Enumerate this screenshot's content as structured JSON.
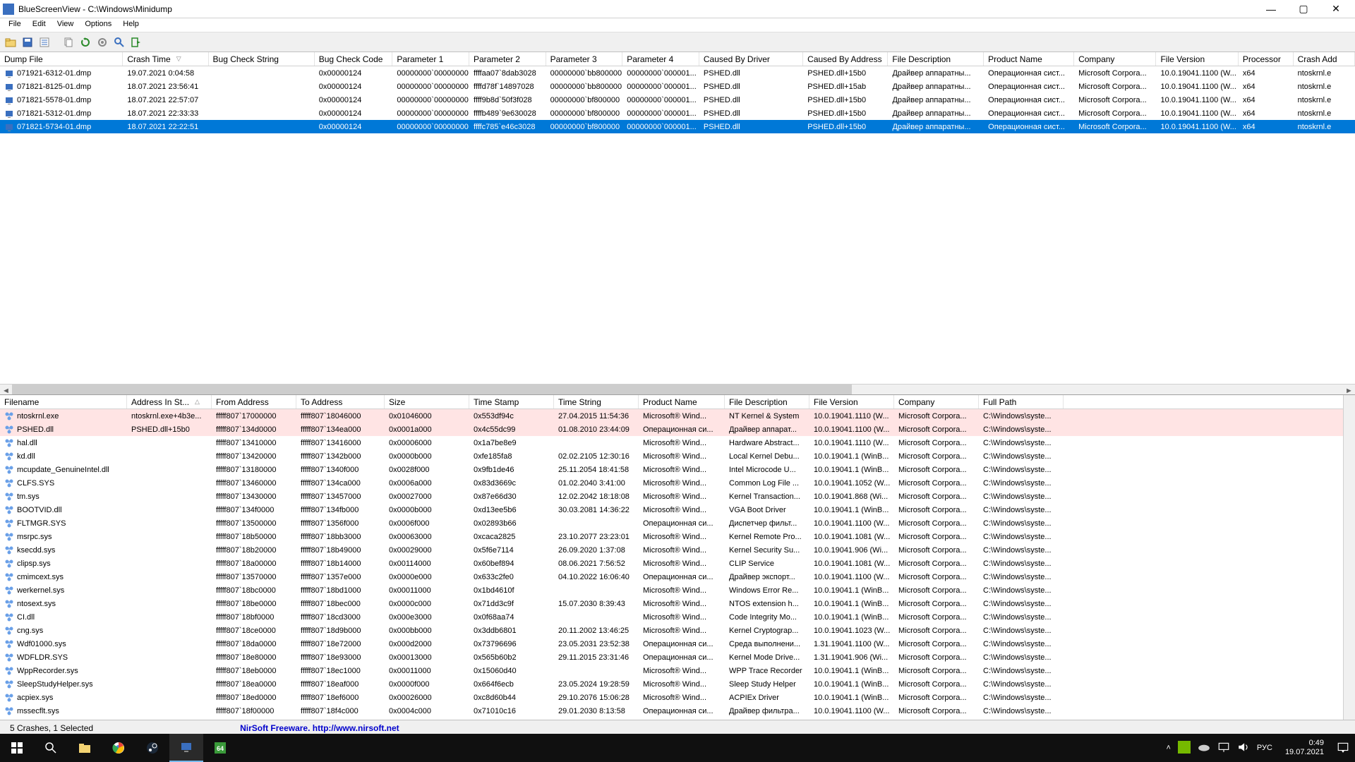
{
  "window": {
    "title": "BlueScreenView - C:\\Windows\\Minidump"
  },
  "menu": [
    "File",
    "Edit",
    "View",
    "Options",
    "Help"
  ],
  "top": {
    "columns": [
      "Dump File",
      "Crash Time",
      "Bug Check String",
      "Bug Check Code",
      "Parameter 1",
      "Parameter 2",
      "Parameter 3",
      "Parameter 4",
      "Caused By Driver",
      "Caused By Address",
      "File Description",
      "Product Name",
      "Company",
      "File Version",
      "Processor",
      "Crash Add"
    ],
    "sorted_col": 1,
    "rows": [
      {
        "sel": false,
        "c": [
          "071921-6312-01.dmp",
          "19.07.2021 0:04:58",
          "",
          "0x00000124",
          "00000000`00000000",
          "ffffaa07`8dab3028",
          "00000000`bb800000",
          "00000000`000001...",
          "PSHED.dll",
          "PSHED.dll+15b0",
          "Драйвер аппаратны...",
          "Операционная сист...",
          "Microsoft Corpora...",
          "10.0.19041.1100 (W...",
          "x64",
          "ntoskrnl.e"
        ]
      },
      {
        "sel": false,
        "c": [
          "071821-8125-01.dmp",
          "18.07.2021 23:56:41",
          "",
          "0x00000124",
          "00000000`00000000",
          "ffffd78f`14897028",
          "00000000`bb800000",
          "00000000`000001...",
          "PSHED.dll",
          "PSHED.dll+15ab",
          "Драйвер аппаратны...",
          "Операционная сист...",
          "Microsoft Corpora...",
          "10.0.19041.1100 (W...",
          "x64",
          "ntoskrnl.e"
        ]
      },
      {
        "sel": false,
        "c": [
          "071821-5578-01.dmp",
          "18.07.2021 22:57:07",
          "",
          "0x00000124",
          "00000000`00000000",
          "ffff9b8d`50f3f028",
          "00000000`bf800000",
          "00000000`000001...",
          "PSHED.dll",
          "PSHED.dll+15b0",
          "Драйвер аппаратны...",
          "Операционная сист...",
          "Microsoft Corpora...",
          "10.0.19041.1100 (W...",
          "x64",
          "ntoskrnl.e"
        ]
      },
      {
        "sel": false,
        "c": [
          "071821-5312-01.dmp",
          "18.07.2021 22:33:33",
          "",
          "0x00000124",
          "00000000`00000000",
          "ffffb489`9e630028",
          "00000000`bf800000",
          "00000000`000001...",
          "PSHED.dll",
          "PSHED.dll+15b0",
          "Драйвер аппаратны...",
          "Операционная сист...",
          "Microsoft Corpora...",
          "10.0.19041.1100 (W...",
          "x64",
          "ntoskrnl.e"
        ]
      },
      {
        "sel": true,
        "c": [
          "071821-5734-01.dmp",
          "18.07.2021 22:22:51",
          "",
          "0x00000124",
          "00000000`00000000",
          "ffffc785`e46c3028",
          "00000000`bf800000",
          "00000000`000001...",
          "PSHED.dll",
          "PSHED.dll+15b0",
          "Драйвер аппаратны...",
          "Операционная сист...",
          "Microsoft Corpora...",
          "10.0.19041.1100 (W...",
          "x64",
          "ntoskrnl.e"
        ]
      }
    ]
  },
  "bottom": {
    "columns": [
      "Filename",
      "Address In St...",
      "From Address",
      "To Address",
      "Size",
      "Time Stamp",
      "Time String",
      "Product Name",
      "File Description",
      "File Version",
      "Company",
      "Full Path"
    ],
    "sorted_col": 1,
    "rows": [
      {
        "pink": true,
        "c": [
          "ntoskrnl.exe",
          "ntoskrnl.exe+4b3e...",
          "fffff807`17000000",
          "fffff807`18046000",
          "0x01046000",
          "0x553df94c",
          "27.04.2015 11:54:36",
          "Microsoft® Wind...",
          "NT Kernel & System",
          "10.0.19041.1110 (W...",
          "Microsoft Corpora...",
          "C:\\Windows\\syste..."
        ]
      },
      {
        "pink": true,
        "c": [
          "PSHED.dll",
          "PSHED.dll+15b0",
          "fffff807`134d0000",
          "fffff807`134ea000",
          "0x0001a000",
          "0x4c55dc99",
          "01.08.2010 23:44:09",
          "Операционная си...",
          "Драйвер аппарат...",
          "10.0.19041.1100 (W...",
          "Microsoft Corpora...",
          "C:\\Windows\\syste..."
        ]
      },
      {
        "pink": false,
        "c": [
          "hal.dll",
          "",
          "fffff807`13410000",
          "fffff807`13416000",
          "0x00006000",
          "0x1a7be8e9",
          "",
          "Microsoft® Wind...",
          "Hardware Abstract...",
          "10.0.19041.1110 (W...",
          "Microsoft Corpora...",
          "C:\\Windows\\syste..."
        ]
      },
      {
        "pink": false,
        "c": [
          "kd.dll",
          "",
          "fffff807`13420000",
          "fffff807`1342b000",
          "0x0000b000",
          "0xfe185fa8",
          "02.02.2105 12:30:16",
          "Microsoft® Wind...",
          "Local Kernel Debu...",
          "10.0.19041.1 (WinB...",
          "Microsoft Corpora...",
          "C:\\Windows\\syste..."
        ]
      },
      {
        "pink": false,
        "c": [
          "mcupdate_GenuineIntel.dll",
          "",
          "fffff807`13180000",
          "fffff807`1340f000",
          "0x0028f000",
          "0x9fb1de46",
          "25.11.2054 18:41:58",
          "Microsoft® Wind...",
          "Intel Microcode U...",
          "10.0.19041.1 (WinB...",
          "Microsoft Corpora...",
          "C:\\Windows\\syste..."
        ]
      },
      {
        "pink": false,
        "c": [
          "CLFS.SYS",
          "",
          "fffff807`13460000",
          "fffff807`134ca000",
          "0x0006a000",
          "0x83d3669c",
          "01.02.2040 3:41:00",
          "Microsoft® Wind...",
          "Common Log File ...",
          "10.0.19041.1052 (W...",
          "Microsoft Corpora...",
          "C:\\Windows\\syste..."
        ]
      },
      {
        "pink": false,
        "c": [
          "tm.sys",
          "",
          "fffff807`13430000",
          "fffff807`13457000",
          "0x00027000",
          "0x87e66d30",
          "12.02.2042 18:18:08",
          "Microsoft® Wind...",
          "Kernel Transaction...",
          "10.0.19041.868 (Wi...",
          "Microsoft Corpora...",
          "C:\\Windows\\syste..."
        ]
      },
      {
        "pink": false,
        "c": [
          "BOOTVID.dll",
          "",
          "fffff807`134f0000",
          "fffff807`134fb000",
          "0x0000b000",
          "0xd13ee5b6",
          "30.03.2081 14:36:22",
          "Microsoft® Wind...",
          "VGA Boot Driver",
          "10.0.19041.1 (WinB...",
          "Microsoft Corpora...",
          "C:\\Windows\\syste..."
        ]
      },
      {
        "pink": false,
        "c": [
          "FLTMGR.SYS",
          "",
          "fffff807`13500000",
          "fffff807`1356f000",
          "0x0006f000",
          "0x02893b66",
          "",
          "Операционная си...",
          "Диспетчер фильт...",
          "10.0.19041.1100 (W...",
          "Microsoft Corpora...",
          "C:\\Windows\\syste..."
        ]
      },
      {
        "pink": false,
        "c": [
          "msrpc.sys",
          "",
          "fffff807`18b50000",
          "fffff807`18bb3000",
          "0x00063000",
          "0xcaca2825",
          "23.10.2077 23:23:01",
          "Microsoft® Wind...",
          "Kernel Remote Pro...",
          "10.0.19041.1081 (W...",
          "Microsoft Corpora...",
          "C:\\Windows\\syste..."
        ]
      },
      {
        "pink": false,
        "c": [
          "ksecdd.sys",
          "",
          "fffff807`18b20000",
          "fffff807`18b49000",
          "0x00029000",
          "0x5f6e7114",
          "26.09.2020 1:37:08",
          "Microsoft® Wind...",
          "Kernel Security Su...",
          "10.0.19041.906 (Wi...",
          "Microsoft Corpora...",
          "C:\\Windows\\syste..."
        ]
      },
      {
        "pink": false,
        "c": [
          "clipsp.sys",
          "",
          "fffff807`18a00000",
          "fffff807`18b14000",
          "0x00114000",
          "0x60bef894",
          "08.06.2021 7:56:52",
          "Microsoft® Wind...",
          "CLIP Service",
          "10.0.19041.1081 (W...",
          "Microsoft Corpora...",
          "C:\\Windows\\syste..."
        ]
      },
      {
        "pink": false,
        "c": [
          "cmimcext.sys",
          "",
          "fffff807`13570000",
          "fffff807`1357e000",
          "0x0000e000",
          "0x633c2fe0",
          "04.10.2022 16:06:40",
          "Операционная си...",
          "Драйвер экспорт...",
          "10.0.19041.1100 (W...",
          "Microsoft Corpora...",
          "C:\\Windows\\syste..."
        ]
      },
      {
        "pink": false,
        "c": [
          "werkernel.sys",
          "",
          "fffff807`18bc0000",
          "fffff807`18bd1000",
          "0x00011000",
          "0x1bd4610f",
          "",
          "Microsoft® Wind...",
          "Windows Error Re...",
          "10.0.19041.1 (WinB...",
          "Microsoft Corpora...",
          "C:\\Windows\\syste..."
        ]
      },
      {
        "pink": false,
        "c": [
          "ntosext.sys",
          "",
          "fffff807`18be0000",
          "fffff807`18bec000",
          "0x0000c000",
          "0x71dd3c9f",
          "15.07.2030 8:39:43",
          "Microsoft® Wind...",
          "NTOS extension h...",
          "10.0.19041.1 (WinB...",
          "Microsoft Corpora...",
          "C:\\Windows\\syste..."
        ]
      },
      {
        "pink": false,
        "c": [
          "CI.dll",
          "",
          "fffff807`18bf0000",
          "fffff807`18cd3000",
          "0x000e3000",
          "0x0f68aa74",
          "",
          "Microsoft® Wind...",
          "Code Integrity Mo...",
          "10.0.19041.1 (WinB...",
          "Microsoft Corpora...",
          "C:\\Windows\\syste..."
        ]
      },
      {
        "pink": false,
        "c": [
          "cng.sys",
          "",
          "fffff807`18ce0000",
          "fffff807`18d9b000",
          "0x000bb000",
          "0x3ddb6801",
          "20.11.2002 13:46:25",
          "Microsoft® Wind...",
          "Kernel Cryptograp...",
          "10.0.19041.1023 (W...",
          "Microsoft Corpora...",
          "C:\\Windows\\syste..."
        ]
      },
      {
        "pink": false,
        "c": [
          "Wdf01000.sys",
          "",
          "fffff807`18da0000",
          "fffff807`18e72000",
          "0x000d2000",
          "0x73796696",
          "23.05.2031 23:52:38",
          "Операционная си...",
          "Среда выполнени...",
          "1.31.19041.1100 (W...",
          "Microsoft Corpora...",
          "C:\\Windows\\syste..."
        ]
      },
      {
        "pink": false,
        "c": [
          "WDFLDR.SYS",
          "",
          "fffff807`18e80000",
          "fffff807`18e93000",
          "0x00013000",
          "0x565b60b2",
          "29.11.2015 23:31:46",
          "Операционная си...",
          "Kernel Mode Drive...",
          "1.31.19041.906 (Wi...",
          "Microsoft Corpora...",
          "C:\\Windows\\syste..."
        ]
      },
      {
        "pink": false,
        "c": [
          "WppRecorder.sys",
          "",
          "fffff807`18eb0000",
          "fffff807`18ec1000",
          "0x00011000",
          "0x15060d40",
          "",
          "Microsoft® Wind...",
          "WPP Trace Recorder",
          "10.0.19041.1 (WinB...",
          "Microsoft Corpora...",
          "C:\\Windows\\syste..."
        ]
      },
      {
        "pink": false,
        "c": [
          "SleepStudyHelper.sys",
          "",
          "fffff807`18ea0000",
          "fffff807`18eaf000",
          "0x0000f000",
          "0x664f6ecb",
          "23.05.2024 19:28:59",
          "Microsoft® Wind...",
          "Sleep Study Helper",
          "10.0.19041.1 (WinB...",
          "Microsoft Corpora...",
          "C:\\Windows\\syste..."
        ]
      },
      {
        "pink": false,
        "c": [
          "acpiex.sys",
          "",
          "fffff807`18ed0000",
          "fffff807`18ef6000",
          "0x00026000",
          "0xc8d60b44",
          "29.10.2076 15:06:28",
          "Microsoft® Wind...",
          "ACPIEx Driver",
          "10.0.19041.1 (WinB...",
          "Microsoft Corpora...",
          "C:\\Windows\\syste..."
        ]
      },
      {
        "pink": false,
        "c": [
          "mssecflt.sys",
          "",
          "fffff807`18f00000",
          "fffff807`18f4c000",
          "0x0004c000",
          "0x71010c16",
          "29.01.2030 8:13:58",
          "Операционная си...",
          "Драйвер фильтра...",
          "10.0.19041.1100 (W...",
          "Microsoft Corpora...",
          "C:\\Windows\\syste..."
        ]
      }
    ]
  },
  "status": {
    "count": "5 Crashes, 1 Selected",
    "credit": "NirSoft Freeware.  http://www.nirsoft.net"
  },
  "tray": {
    "lang": "РУС",
    "time": "0:49",
    "date": "19.07.2021"
  }
}
